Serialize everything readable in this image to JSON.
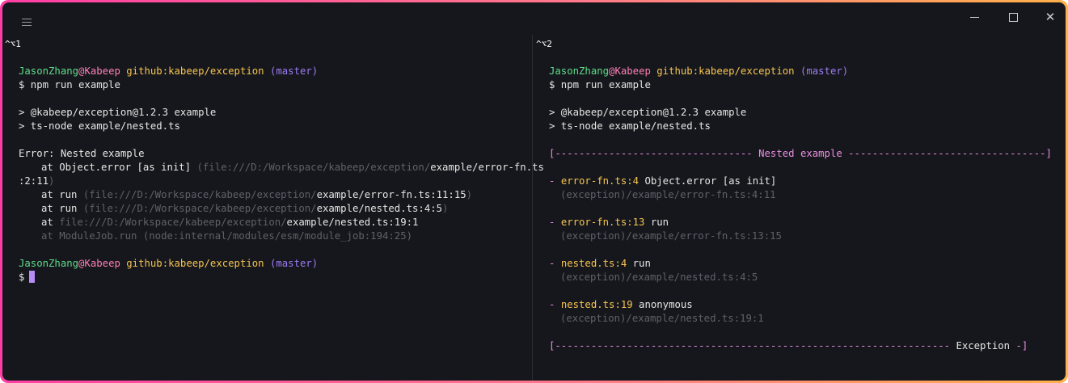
{
  "window": {
    "menu_icon": "hamburger-icon",
    "controls": [
      "minimize-icon",
      "maximize-icon",
      "close-icon"
    ],
    "close_glyph": "✕"
  },
  "colors": {
    "border_gradient": [
      "#ff3ea5",
      "#ff7a8a",
      "#ffb14a"
    ],
    "background": "#16171c",
    "user": "#5fdc8a",
    "host": "#ff7eb6",
    "repo": "#f5c451",
    "branch": "#9d7cf5",
    "dim": "#5f616a",
    "cursor": "#b68cf5"
  },
  "left_pane": {
    "label": "^⌥1",
    "prompt": {
      "user": "JasonZhang",
      "host": "@Kabeep",
      "repo": "github:kabeep/exception",
      "branch": "(master)"
    },
    "command": "$ npm run example",
    "script_lines": [
      "> @kabeep/exception@1.2.3 example",
      "> ts-node example/nested.ts"
    ],
    "error_title": "Error: Nested example",
    "stack": {
      "line1_at": "at Object.error [as init] ",
      "line1_dim": "(file:///D:/Workspace/kabeep/exception/",
      "line1_file": "example/error-fn.ts",
      "line1b_file": ":2:11",
      "line1b_close": ")",
      "line2_at": "at run ",
      "line2_dim": "(file:///D:/Workspace/kabeep/exception/",
      "line2_file": "example/error-fn.ts:11:15",
      "line2_close": ")",
      "line3_at": "at run ",
      "line3_dim": "(file:///D:/Workspace/kabeep/exception/",
      "line3_file": "example/nested.ts:4:5",
      "line3_close": ")",
      "line4_at": "at ",
      "line4_dim": "file:///D:/Workspace/kabeep/exception/",
      "line4_file": "example/nested.ts:19:1",
      "line5": "at ModuleJob.run (node:internal/modules/esm/module_job:194:25)"
    },
    "prompt2": {
      "user": "JasonZhang",
      "host": "@Kabeep",
      "repo": "github:kabeep/exception",
      "branch": "(master)"
    },
    "dollar": "$"
  },
  "right_pane": {
    "label": "^⌥2",
    "prompt": {
      "user": "JasonZhang",
      "host": "@Kabeep",
      "repo": "github:kabeep/exception",
      "branch": "(master)"
    },
    "command": "$ npm run example",
    "script_lines": [
      "> @kabeep/exception@1.2.3 example",
      "> ts-node example/nested.ts"
    ],
    "header": {
      "left": "[--------------------------------- ",
      "title": "Nested example",
      "right": " ---------------------------------]"
    },
    "frames": [
      {
        "dash": "- ",
        "file": "error-fn.ts:4",
        "fn": " Object.error [as init]",
        "path": "(exception)/example/error-fn.ts:4:11"
      },
      {
        "dash": "- ",
        "file": "error-fn.ts:13",
        "fn": " run",
        "path": "(exception)/example/error-fn.ts:13:15"
      },
      {
        "dash": "- ",
        "file": "nested.ts:4",
        "fn": " run",
        "path": "(exception)/example/nested.ts:4:5"
      },
      {
        "dash": "- ",
        "file": "nested.ts:19",
        "fn": " anonymous",
        "path": "(exception)/example/nested.ts:19:1"
      }
    ],
    "footer": {
      "left": "[------------------------------------------------------------------ ",
      "title": "Exception",
      "right": " -]"
    }
  }
}
